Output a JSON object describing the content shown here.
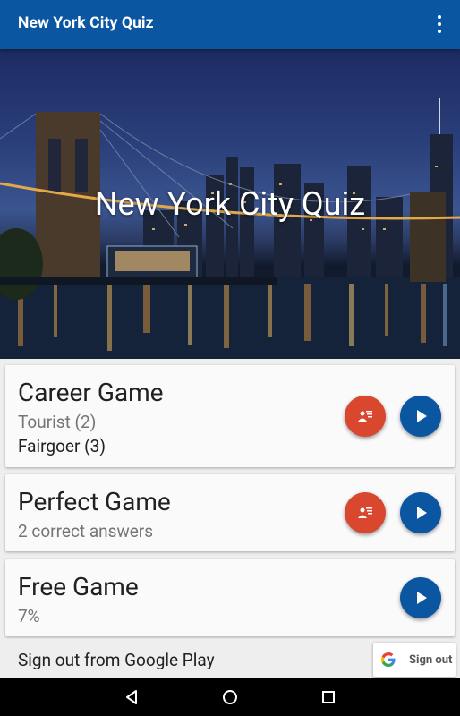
{
  "appbar": {
    "title": "New York City Quiz",
    "menu_icon": "overflow-menu-icon"
  },
  "hero": {
    "title": "New York City Quiz"
  },
  "cards": [
    {
      "title": "Career Game",
      "line1": "Tourist (2)",
      "line2": "Fairgoer (3)",
      "has_leaderboard": true
    },
    {
      "title": "Perfect Game",
      "line1": "2 correct answers",
      "has_leaderboard": true
    },
    {
      "title": "Free Game",
      "line1": "7%",
      "has_leaderboard": false
    }
  ],
  "signout": {
    "text": "Sign out from Google Play",
    "button_label": "Sign out"
  },
  "colors": {
    "primary": "#0b56a0",
    "accent": "#d9472f"
  }
}
